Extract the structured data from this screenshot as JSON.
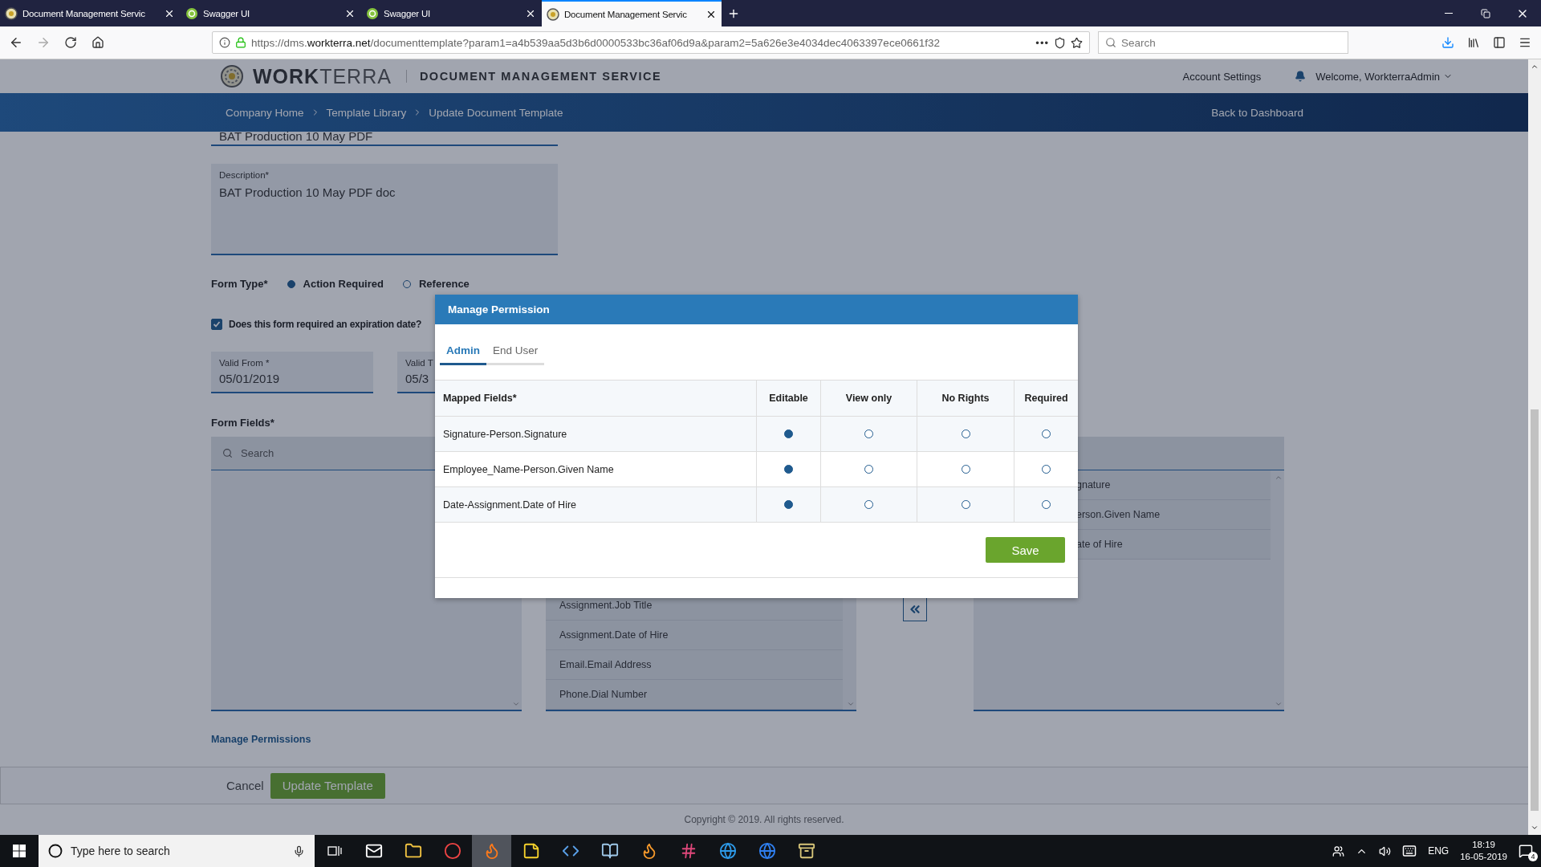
{
  "browser": {
    "tabs": [
      {
        "title": "Document Management Servic",
        "kind": "app",
        "selected": false
      },
      {
        "title": "Swagger UI",
        "kind": "swagger",
        "selected": false
      },
      {
        "title": "Swagger UI",
        "kind": "swagger",
        "selected": false
      },
      {
        "title": "Document Management Servic",
        "kind": "app",
        "selected": true
      }
    ],
    "url": "https://dms.**workterra.net**/documenttemplate?param1=a4b539aa5d3b6d0000533bc36af06d9a&param2=5a626e3e4034dec4063397ece0661f32",
    "more": "•••",
    "search_placeholder": "Search"
  },
  "header": {
    "brand": "**WORK**TERRA",
    "service": "DOCUMENT MANAGEMENT SERVICE",
    "account": "Account Settings",
    "welcome": "Welcome, WorkterraAdmin"
  },
  "breadcrumbs": [
    "Company Home",
    "Template Library",
    "Update Document Template"
  ],
  "back_link": "Back to Dashboard",
  "form": {
    "title_value": "BAT Production 10 May PDF",
    "description": {
      "label": "Description*",
      "value": "BAT Production 10 May PDF doc"
    },
    "form_type": {
      "label": "Form Type*",
      "options": [
        {
          "label": "Action Required",
          "selected": true
        },
        {
          "label": "Reference",
          "selected": false
        }
      ]
    },
    "expiration": {
      "label": "Does this form required an expiration date?",
      "checked": true
    },
    "dates": [
      {
        "label": "Valid From *",
        "value": "05/01/2019"
      },
      {
        "label": "Valid T",
        "value": "05/3"
      }
    ],
    "fields_label": "Form Fields*",
    "search_placeholder": "Search",
    "middle_items": [
      "Assignment.Job Title",
      "Assignment.Date of Hire",
      "Email.Email Address",
      "Phone.Dial Number"
    ],
    "right_items": [
      "gnature",
      "erson.Given Name",
      "ate of Hire"
    ],
    "manage_link": "Manage Permissions"
  },
  "actions": {
    "cancel": "Cancel",
    "submit": "Update Template"
  },
  "copyright": "Copyright © 2019. All rights reserved.",
  "modal": {
    "title": "Manage Permission",
    "tabs": [
      {
        "label": "Admin",
        "selected": true
      },
      {
        "label": "End User",
        "selected": false
      }
    ],
    "columns": [
      "Mapped Fields*",
      "Editable",
      "View only",
      "No Rights",
      "Required"
    ],
    "rows": [
      {
        "field": "Signature-Person.Signature",
        "options": [
          {
            "selected": true
          },
          {
            "selected": false
          },
          {
            "selected": false
          },
          {
            "selected": false
          }
        ]
      },
      {
        "field": "Employee_Name-Person.Given Name",
        "options": [
          {
            "selected": true
          },
          {
            "selected": false
          },
          {
            "selected": false
          },
          {
            "selected": false
          }
        ]
      },
      {
        "field": "Date-Assignment.Date of Hire",
        "options": [
          {
            "selected": true
          },
          {
            "selected": false
          },
          {
            "selected": false
          },
          {
            "selected": false
          }
        ]
      }
    ],
    "save": "Save"
  },
  "taskbar": {
    "search_placeholder": "Type here to search",
    "apps": [
      {
        "kind": "mail",
        "selected": false
      },
      {
        "kind": "folder",
        "selected": false
      },
      {
        "kind": "chrome",
        "selected": false
      },
      {
        "kind": "firefox",
        "selected": true
      },
      {
        "kind": "sticky",
        "selected": false
      },
      {
        "kind": "code",
        "selected": false
      },
      {
        "kind": "book",
        "selected": false
      },
      {
        "kind": "flame",
        "selected": false
      },
      {
        "kind": "hash",
        "selected": false
      },
      {
        "kind": "ie",
        "selected": false
      },
      {
        "kind": "edge",
        "selected": false
      },
      {
        "kind": "archive",
        "selected": false
      }
    ],
    "language": "ENG",
    "time": "18:19",
    "date": "16-05-2019",
    "notifications": "4"
  }
}
